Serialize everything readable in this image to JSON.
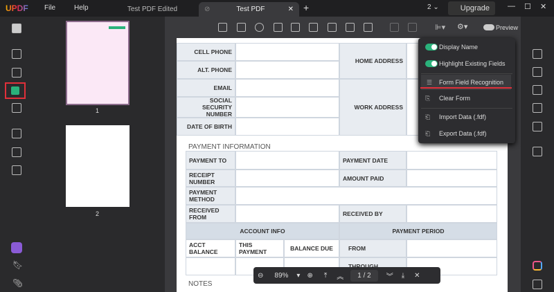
{
  "app": {
    "logo": "UPDF",
    "menu": [
      "File",
      "Help"
    ],
    "tabs": [
      "Test PDF Edited",
      "Test PDF"
    ],
    "page_count_badge": "2",
    "upgrade": "Upgrade"
  },
  "toolbar": {
    "preview": "Preview"
  },
  "thumbnails": [
    {
      "label": "1"
    },
    {
      "label": "2"
    }
  ],
  "personal": {
    "rows": [
      "CELL PHONE",
      "ALT. PHONE",
      "EMAIL",
      "SOCIAL SECURITY NUMBER",
      "DATE OF BIRTH"
    ],
    "right": [
      "HOME ADDRESS",
      "WORK ADDRESS"
    ]
  },
  "payment": {
    "title": "PAYMENT INFORMATION",
    "payment_to": "PAYMENT TO",
    "payment_date": "PAYMENT DATE",
    "receipt_number": "RECEIPT NUMBER",
    "amount_paid": "AMOUNT PAID",
    "payment_method": "PAYMENT METHOD",
    "received_from": "RECEIVED FROM",
    "received_by": "RECEIVED BY",
    "account_info": "ACCOUNT INFO",
    "payment_period": "PAYMENT PERIOD",
    "acct_balance": "ACCT BALANCE",
    "this_payment": "THIS PAYMENT",
    "balance_due": "BALANCE DUE",
    "from": "FROM",
    "through": "THROUGH"
  },
  "notes": "NOTES",
  "menu": {
    "display_name": "Display Name",
    "highlight": "Highlight Existing Fields",
    "recognition": "Form Field Recognition",
    "clear": "Clear Form",
    "import": "Import Data (.fdf)",
    "export": "Export Data (.fdf)"
  },
  "zoom": {
    "level": "89%",
    "current_page": "1",
    "separator": "/",
    "total_pages": "2"
  },
  "colors": {
    "accent": "#2ab27b",
    "highlight_red": "#e0303a"
  }
}
